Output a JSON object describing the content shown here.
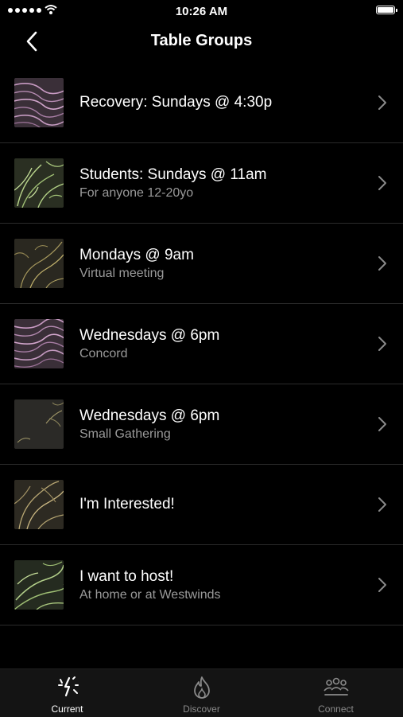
{
  "status_bar": {
    "time": "10:26 AM"
  },
  "nav": {
    "title": "Table Groups",
    "back_icon": "chevron-left-icon"
  },
  "groups": [
    {
      "title": "Recovery: Sundays @ 4:30p",
      "subtitle": "",
      "pattern": "pink-waves"
    },
    {
      "title": "Students: Sundays @ 11am",
      "subtitle": "For anyone 12-20yo",
      "pattern": "green-leaves"
    },
    {
      "title": "Mondays @ 9am",
      "subtitle": "Virtual meeting",
      "pattern": "gold-swirls"
    },
    {
      "title": "Wednesdays @ 6pm",
      "subtitle": "Concord",
      "pattern": "pink-waves"
    },
    {
      "title": "Wednesdays @ 6pm",
      "subtitle": "Small Gathering",
      "pattern": "gold-leaves-sparse"
    },
    {
      "title": "I'm Interested!",
      "subtitle": "",
      "pattern": "gold-leaves"
    },
    {
      "title": "I want to host!",
      "subtitle": "At home or at Westwinds",
      "pattern": "green-leaves"
    }
  ],
  "tabs": [
    {
      "label": "Current",
      "icon": "sparkle-icon",
      "active": true
    },
    {
      "label": "Discover",
      "icon": "flame-icon",
      "active": false
    },
    {
      "label": "Connect",
      "icon": "people-icon",
      "active": false
    }
  ],
  "colors": {
    "background": "#000000",
    "tab_bar": "#141414",
    "divider": "#2b2b2b",
    "subtitle": "#9a9a9a",
    "inactive_tab": "#8a8a8a"
  }
}
